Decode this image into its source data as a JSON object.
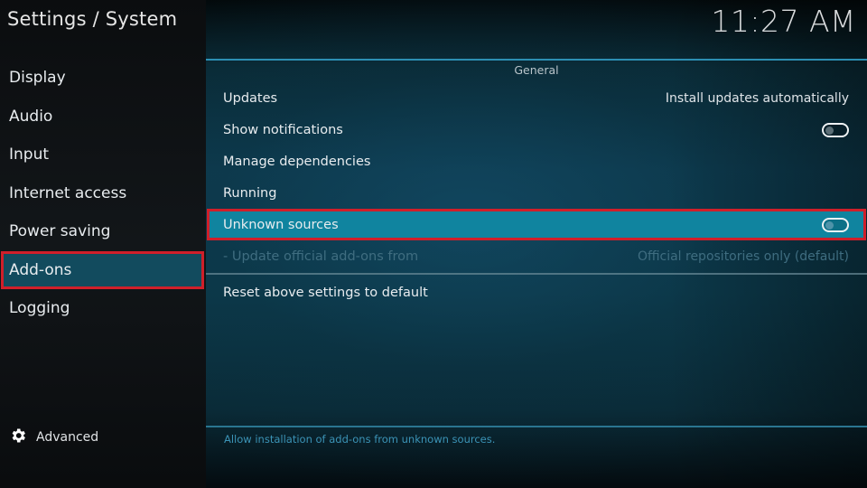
{
  "header": {
    "title": "Settings / System",
    "clock": "11:27 AM"
  },
  "sidebar": {
    "items": [
      {
        "label": "Display",
        "selected": false
      },
      {
        "label": "Audio",
        "selected": false
      },
      {
        "label": "Input",
        "selected": false
      },
      {
        "label": "Internet access",
        "selected": false
      },
      {
        "label": "Power saving",
        "selected": false
      },
      {
        "label": "Add-ons",
        "selected": true
      },
      {
        "label": "Logging",
        "selected": false
      }
    ],
    "advanced": {
      "icon": "gear-icon",
      "label": "Advanced"
    }
  },
  "content": {
    "section_header": "General",
    "settings": [
      {
        "label": "Updates",
        "value": "Install updates automatically"
      },
      {
        "label": "Show notifications",
        "toggle": "off"
      },
      {
        "label": "Manage dependencies"
      },
      {
        "label": "Running"
      },
      {
        "label": "Unknown sources",
        "toggle": "off",
        "focused": true
      },
      {
        "label": "- Update official add-ons from",
        "value": "Official repositories only (default)",
        "disabled": true
      },
      {
        "label": "Reset above settings to default"
      }
    ],
    "description": "Allow installation of add-ons from unknown sources."
  },
  "colors": {
    "accent": "#10849f",
    "highlight_border": "#d01f2a",
    "sidebar_selected": "#124b5e",
    "divider": "#2c8fb3",
    "description_text": "#3b93b6"
  }
}
